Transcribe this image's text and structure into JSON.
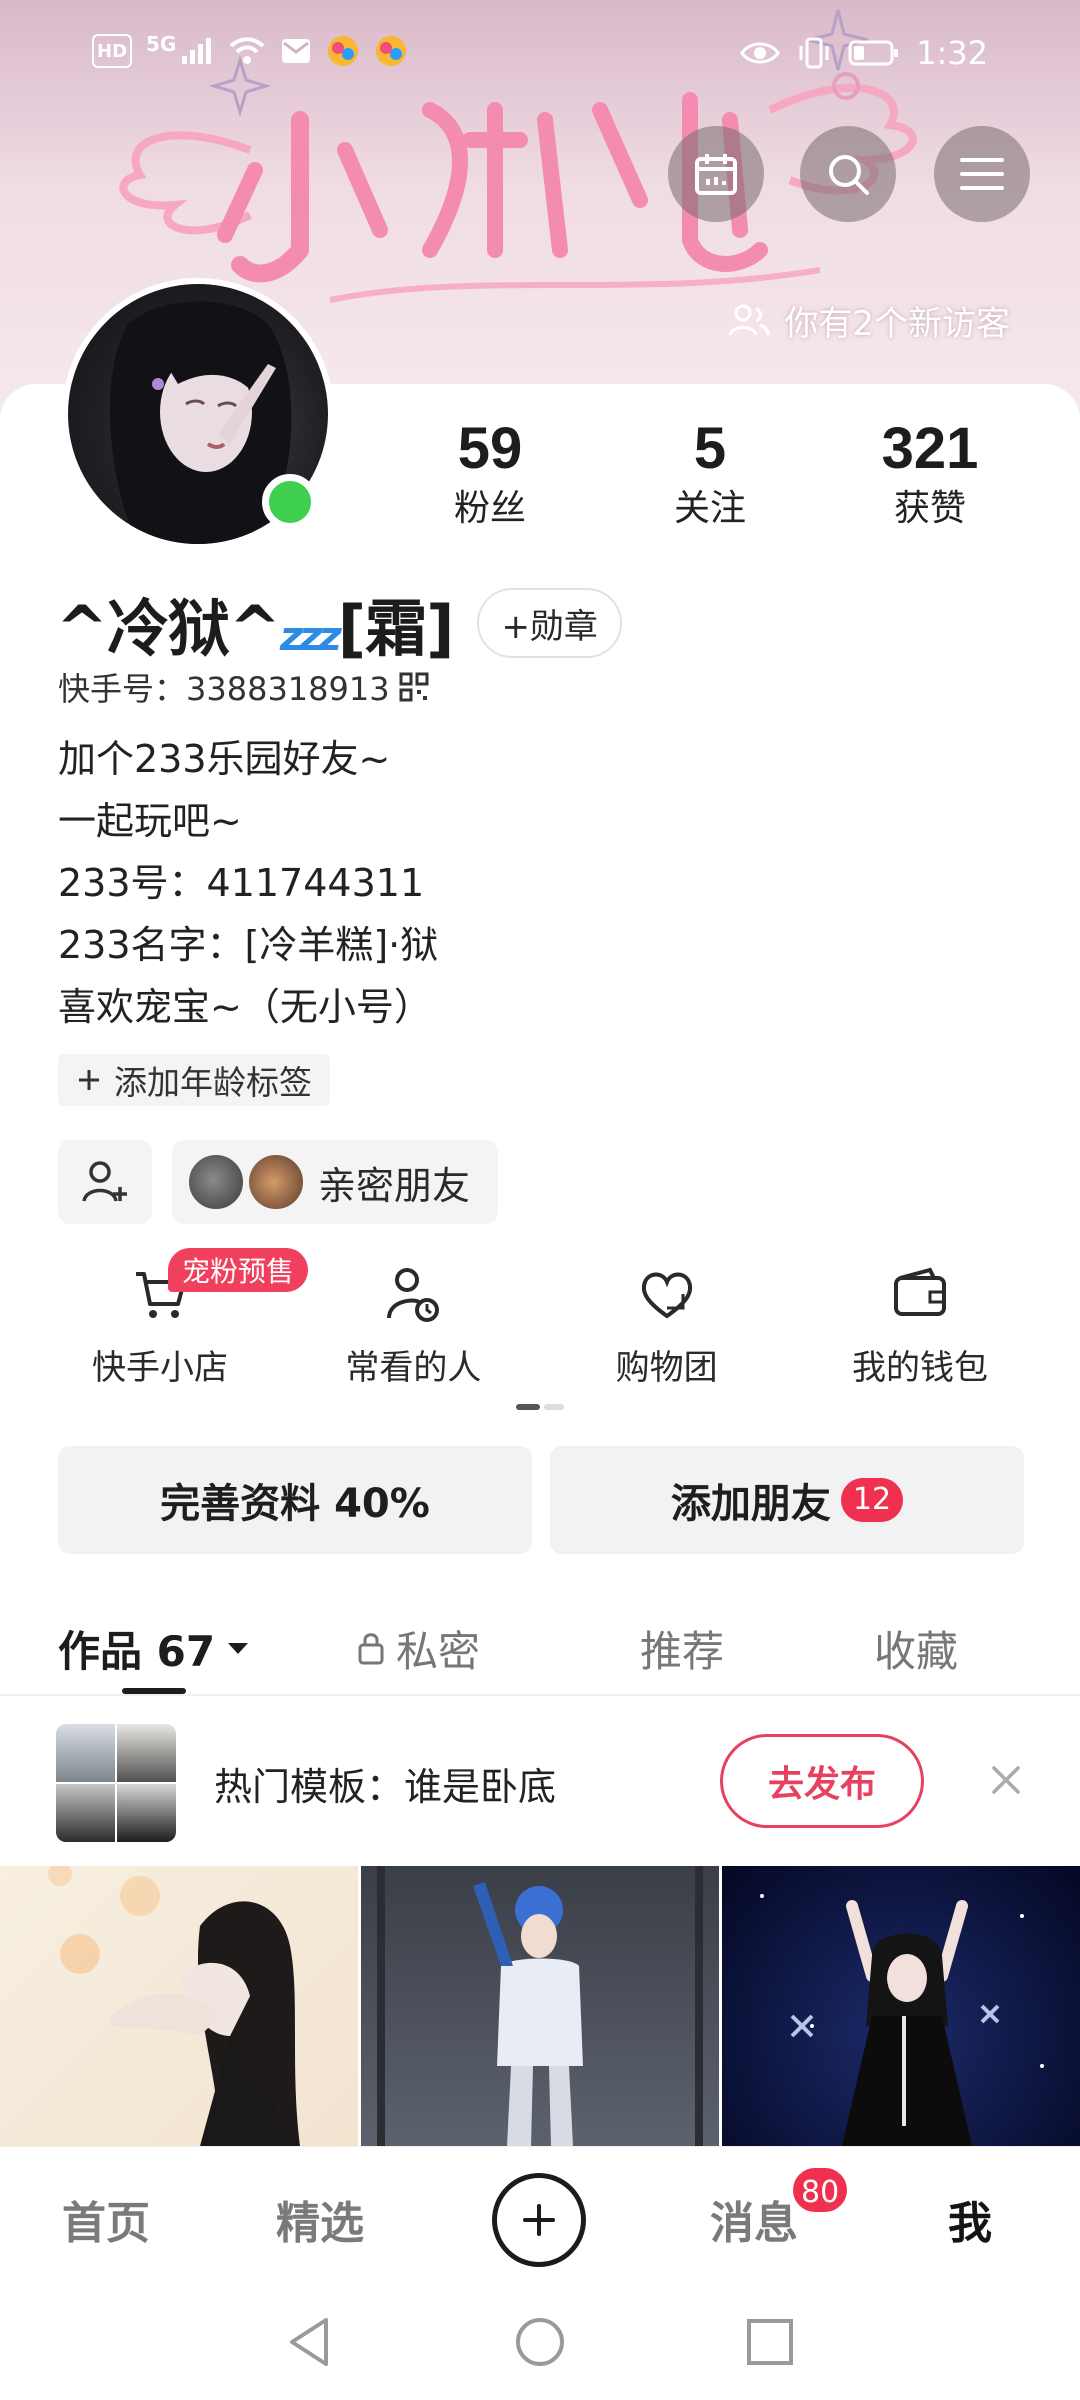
{
  "status_bar": {
    "left_labels": [
      "HD",
      "5G"
    ],
    "time": "1:32"
  },
  "banner": {
    "visitor_text": "你有2个新访客"
  },
  "profile": {
    "stats": [
      {
        "value": "59",
        "label": "粉丝"
      },
      {
        "value": "5",
        "label": "关注"
      },
      {
        "value": "321",
        "label": "获赞"
      }
    ],
    "name": "^冷狱^",
    "name_suffix": "[霜]",
    "zzz": "zzz",
    "badge_button": "+勋章",
    "kuaishou_id": "快手号：3388318913",
    "bio_lines": [
      "加个233乐园好友~",
      "一起玩吧~",
      "233号：411744311",
      "233名字：[冷羊糕]·狱",
      "喜欢宠宝~（无小号）"
    ],
    "age_tag": "添加年龄标签",
    "intimate_friends": "亲密朋友"
  },
  "tools": [
    {
      "label": "快手小店",
      "icon": "cart-icon",
      "badge": "宠粉预售"
    },
    {
      "label": "常看的人",
      "icon": "person-clock-icon"
    },
    {
      "label": "购物团",
      "icon": "heart-bag-icon"
    },
    {
      "label": "我的钱包",
      "icon": "wallet-icon"
    }
  ],
  "actions": {
    "complete_profile": "完善资料 40%",
    "add_friends": "添加朋友",
    "add_friends_count": "12"
  },
  "tabs": [
    {
      "label": "作品 67",
      "active": true
    },
    {
      "label": "私密",
      "active": false
    },
    {
      "label": "推荐",
      "active": false
    },
    {
      "label": "收藏",
      "active": false
    }
  ],
  "template_bar": {
    "text": "热门模板：谁是卧底",
    "button": "去发布"
  },
  "bottom_nav": {
    "items": [
      {
        "label": "首页"
      },
      {
        "label": "精选"
      },
      {
        "label": "消息"
      },
      {
        "label": "我"
      }
    ],
    "message_badge": "80"
  },
  "colors": {
    "accent_red": "#f0304f",
    "online_green": "#3fcf4f",
    "banner_pink": "#f08aa8"
  }
}
